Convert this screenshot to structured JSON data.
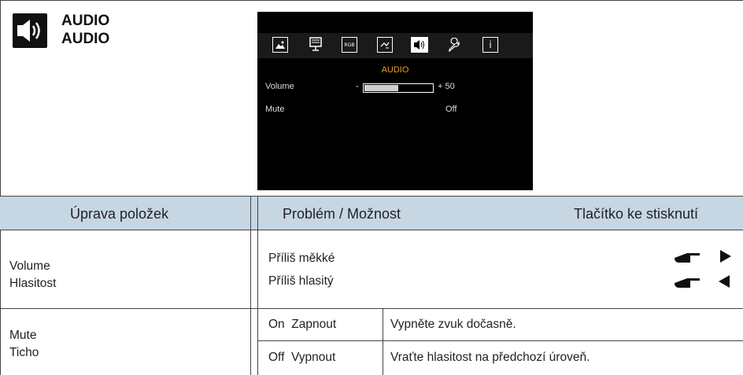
{
  "header": {
    "title_line1": "AUDIO",
    "title_line2": "AUDIO"
  },
  "osd": {
    "section_title": "AUDIO",
    "icons": [
      "picture-icon",
      "display-icon",
      "rgb-icon",
      "input-icon",
      "audio-icon",
      "wrench-icon",
      "info-icon"
    ],
    "rgb_icon_text": "RGB",
    "info_icon_text": "i",
    "volume_label": "Volume",
    "volume_minus": "-",
    "volume_value_text": "+ 50",
    "volume_level": 0.5,
    "mute_label": "Mute",
    "mute_value": "Off",
    "accent_color": "#e8a020"
  },
  "table": {
    "headers": {
      "item": "Úprava položek",
      "problem": "Problém / Možnost",
      "button": "Tlačítko ke stisknutí"
    },
    "volume_row": {
      "label_en": "Volume",
      "label_cs": "Hlasitost",
      "option1": "Příliš měkké",
      "option2": "Příliš hlasitý",
      "button1": "pointing-hand-right-arrow",
      "button2": "pointing-hand-left-arrow"
    },
    "mute_row": {
      "label_en": "Mute",
      "label_cs": "Ticho",
      "on_option": "On  Zapnout",
      "on_desc": "Vypněte zvuk dočasně.",
      "off_option": "Off  Vypnout",
      "off_desc": "Vraťte hlasitost na předchozí úroveň."
    },
    "header_color": "#c7d6e3"
  }
}
